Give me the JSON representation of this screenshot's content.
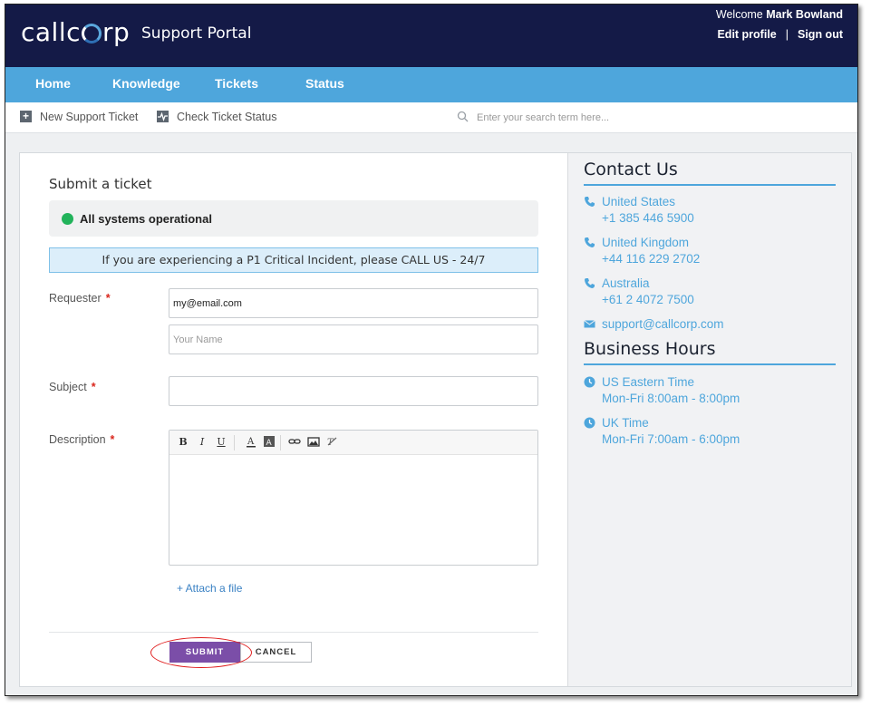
{
  "header": {
    "logo_text_a": "callc",
    "logo_text_b": "rp",
    "portal_title": "Support Portal",
    "welcome_prefix": "Welcome",
    "user_name": "Mark Bowland",
    "edit_profile": "Edit profile",
    "separator": "|",
    "sign_out": "Sign out"
  },
  "nav": {
    "items": [
      "Home",
      "Knowledge",
      "Tickets",
      "Status"
    ]
  },
  "subbar": {
    "new_ticket": "New Support Ticket",
    "check_status": "Check Ticket Status",
    "search_placeholder": "Enter your search term here..."
  },
  "form": {
    "title": "Submit a ticket",
    "status_text": "All systems operational",
    "status_color": "#22b35b",
    "alert_text": "If you are experiencing a P1 Critical Incident, please CALL US - 24/7",
    "requester_label": "Requester",
    "required_mark": "*",
    "requester_email_value": "my@email.com",
    "requester_name_placeholder": "Your Name",
    "subject_label": "Subject",
    "subject_value": "",
    "description_label": "Description",
    "toolbar": {
      "bold": "B",
      "italic": "I",
      "underline": "U"
    },
    "attach_label": "+ Attach a file",
    "submit_label": "SUBMIT",
    "cancel_label": "CANCEL"
  },
  "sidebar": {
    "contact_heading": "Contact Us",
    "contacts": [
      {
        "region": "United States",
        "phone": "+1 385 446 5900"
      },
      {
        "region": "United Kingdom",
        "phone": "+44 116 229 2702"
      },
      {
        "region": "Australia",
        "phone": "+61 2 4072 7500"
      }
    ],
    "email": "support@callcorp.com",
    "hours_heading": "Business Hours",
    "hours": [
      {
        "zone": "US Eastern Time",
        "time": "Mon-Fri 8:00am - 8:00pm"
      },
      {
        "zone": "UK Time",
        "time": "Mon-Fri 7:00am - 6:00pm"
      }
    ]
  },
  "colors": {
    "header_bg": "#141a47",
    "nav_bg": "#4ea6dc",
    "accent": "#4ea6dc",
    "submit_bg": "#7b4ea8",
    "required": "#d9261c",
    "annotation": "#e02020"
  },
  "icons": {
    "new_ticket": "plus-square-icon",
    "check_status": "pulse-square-icon",
    "search": "search-icon",
    "phone": "phone-icon",
    "email": "envelope-icon",
    "clock": "clock-icon"
  }
}
